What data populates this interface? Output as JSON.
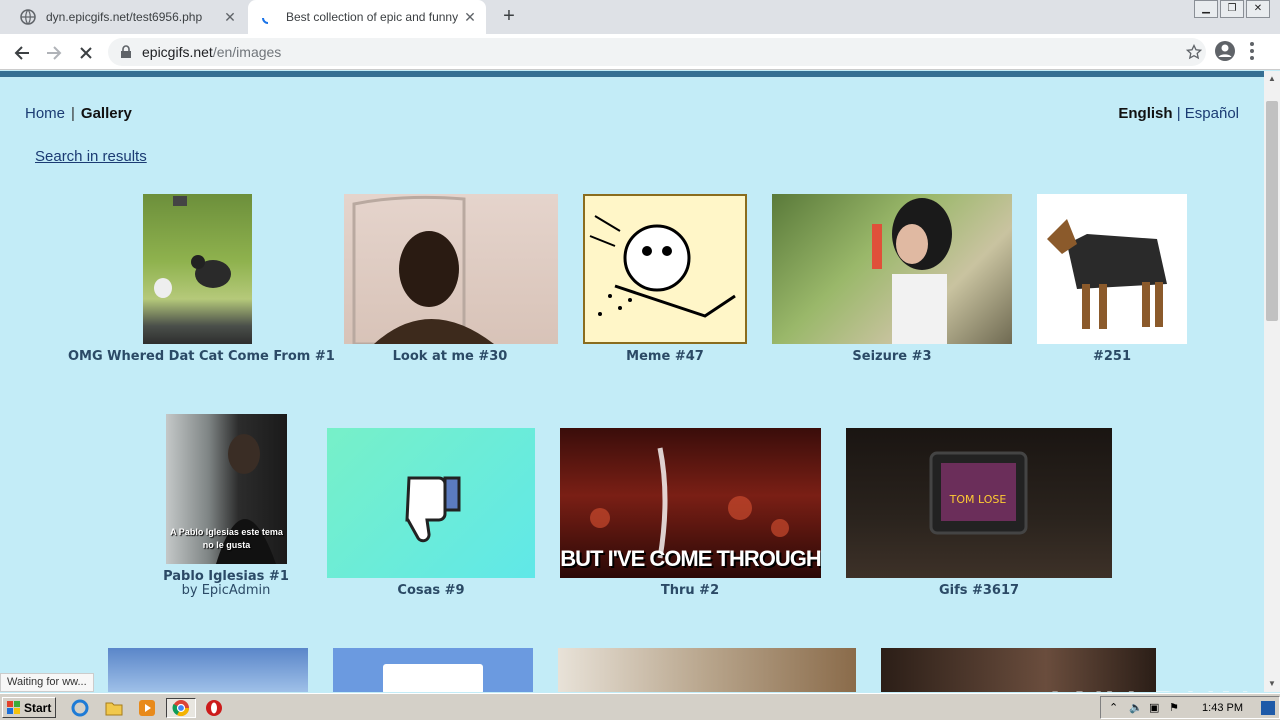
{
  "browser": {
    "tabs": [
      {
        "title": "dyn.epicgifs.net/test6956.php",
        "active": false
      },
      {
        "title": "Best collection of epic and funny gifs",
        "active": true
      }
    ],
    "url_domain": "epicgifs.net",
    "url_path": "/en/images",
    "status": "Waiting for ww..."
  },
  "nav": {
    "home": "Home",
    "separator": "|",
    "gallery": "Gallery",
    "lang_en": "English",
    "lang_es": "Español",
    "search": "Search in results"
  },
  "gallery": {
    "row1": [
      {
        "title": "OMG Whered Dat Cat Come From #1"
      },
      {
        "title": "Look at me #30"
      },
      {
        "title": "Meme #47"
      },
      {
        "title": "Seizure #3"
      },
      {
        "title": "#251"
      }
    ],
    "row2": [
      {
        "title": "Pablo Iglesias #1",
        "byline": "by EpicAdmin",
        "overlay": "A Pablo Iglesias este tema no le gusta"
      },
      {
        "title": "Cosas #9"
      },
      {
        "title": "Thru #2",
        "overlay": "BUT I'VE COME THROUGH"
      },
      {
        "title": "Gifs #3617"
      }
    ]
  },
  "taskbar": {
    "start": "Start",
    "clock": "1:43 PM"
  },
  "watermark": "ANY RUN",
  "colors": {
    "page_bg": "#c3ecf7",
    "link": "#1b3b73",
    "caption": "#2b4a66"
  }
}
